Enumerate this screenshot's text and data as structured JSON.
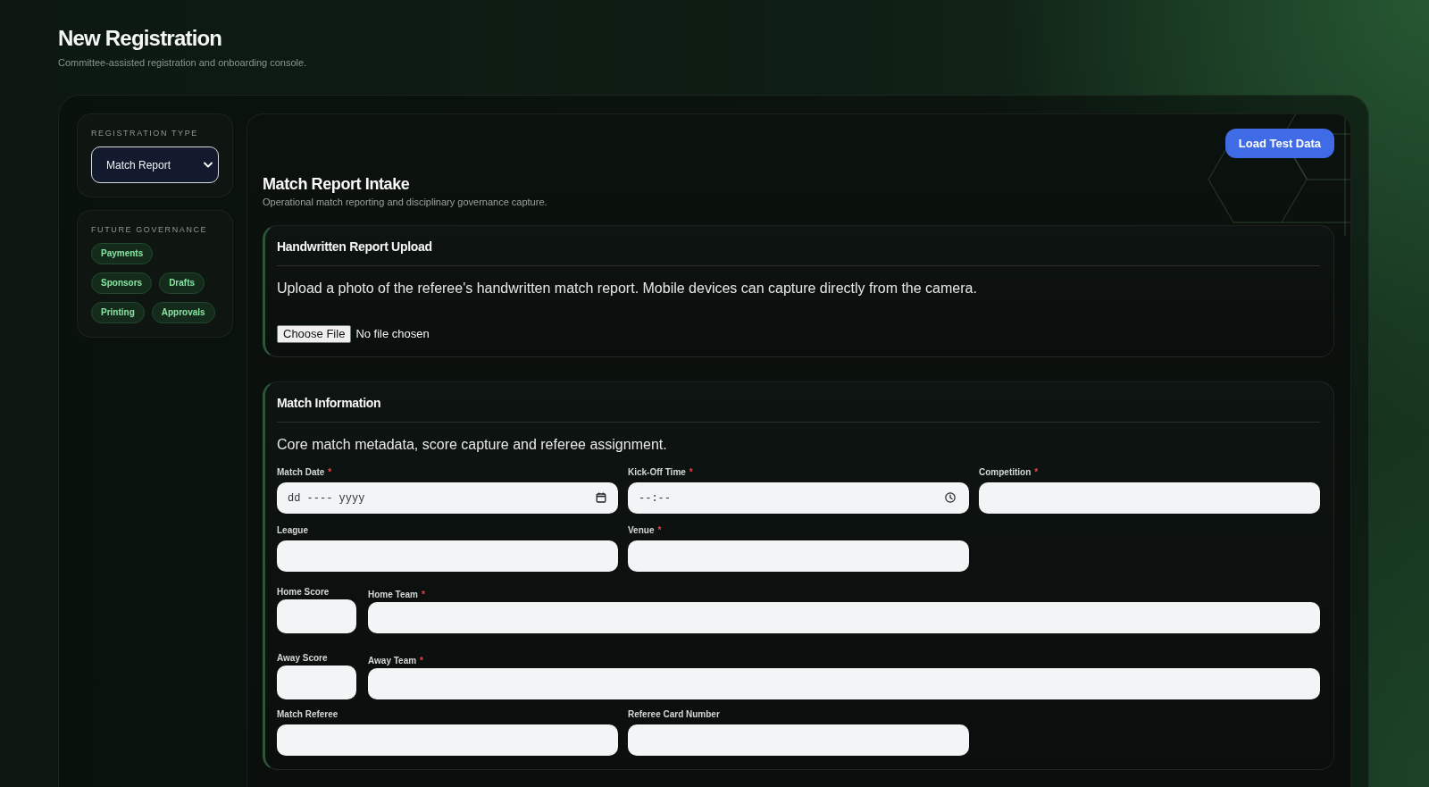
{
  "page": {
    "title": "New Registration",
    "subtitle": "Committee-assisted registration and onboarding console."
  },
  "sidebar": {
    "registration_type": {
      "label": "REGISTRATION TYPE",
      "value": "Match Report"
    },
    "future_governance": {
      "label": "FUTURE GOVERNANCE",
      "tags": [
        "Payments",
        "Sponsors",
        "Drafts",
        "Printing",
        "Approvals"
      ]
    }
  },
  "main": {
    "load_test_data_button": "Load Test Data",
    "title": "Match Report Intake",
    "subtitle": "Operational match reporting and disciplinary governance capture.",
    "required_symbol": "*",
    "sections": [
      {
        "kind": "upload",
        "title": "Handwritten Report Upload",
        "description": "Upload a photo of the referee's handwritten match report. Mobile devices can capture directly from the camera.",
        "file_button": "Choose File",
        "file_status": "No file chosen"
      },
      {
        "kind": "form",
        "title": "Match Information",
        "description": "Core match metadata, score capture and referee assignment.",
        "rows": [
          {
            "kind": "columns",
            "fields": [
              {
                "label": "Match Date",
                "required": true,
                "kind": "date",
                "placeholder": "dd ---- yyyy"
              },
              {
                "label": "Kick-Off Time",
                "required": true,
                "kind": "time",
                "placeholder": "--:--"
              },
              {
                "label": "Competition",
                "required": true,
                "kind": "text"
              }
            ]
          },
          {
            "kind": "columns",
            "fields": [
              {
                "label": "League",
                "required": false,
                "kind": "text"
              },
              {
                "label": "Venue",
                "required": true,
                "kind": "text"
              }
            ]
          },
          {
            "kind": "score",
            "fields": [
              {
                "label": "Home Score",
                "required": false,
                "kind": "score"
              },
              {
                "label": "Home Team",
                "required": true,
                "kind": "text"
              }
            ]
          },
          {
            "kind": "score",
            "fields": [
              {
                "label": "Away Score",
                "required": false,
                "kind": "score"
              },
              {
                "label": "Away Team",
                "required": true,
                "kind": "text"
              }
            ]
          },
          {
            "kind": "columns",
            "fields": [
              {
                "label": "Match Referee",
                "required": false,
                "kind": "text"
              },
              {
                "label": "Referee Card Number",
                "required": false,
                "kind": "text"
              }
            ]
          }
        ]
      }
    ]
  }
}
